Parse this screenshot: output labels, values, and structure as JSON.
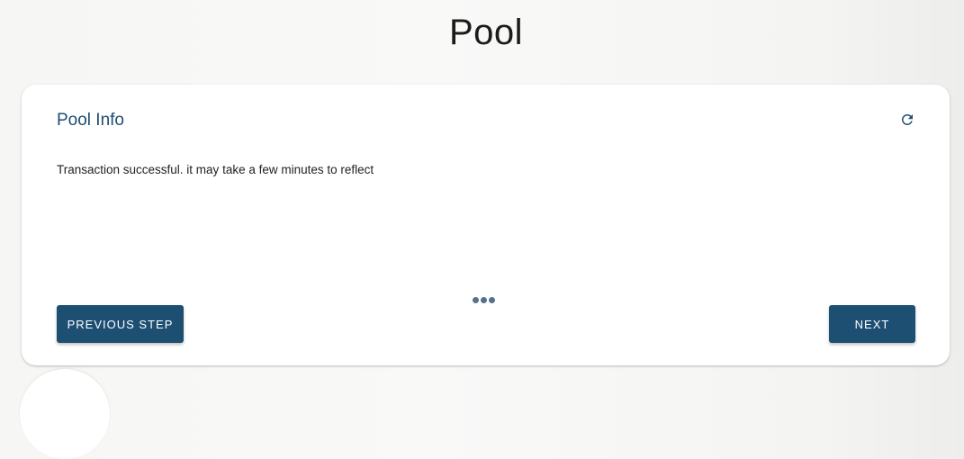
{
  "page": {
    "title": "Pool"
  },
  "card": {
    "title": "Pool Info",
    "refresh_icon": "refresh-icon",
    "message": "Transaction successful. it may take a few minutes to reflect",
    "progress_dots": 3
  },
  "buttons": {
    "previous_label": "PREVIOUS STEP",
    "next_label": "NEXT"
  },
  "colors": {
    "primary": "#1d4f73",
    "title_text": "#1d4d72",
    "dots": "#57718b"
  }
}
